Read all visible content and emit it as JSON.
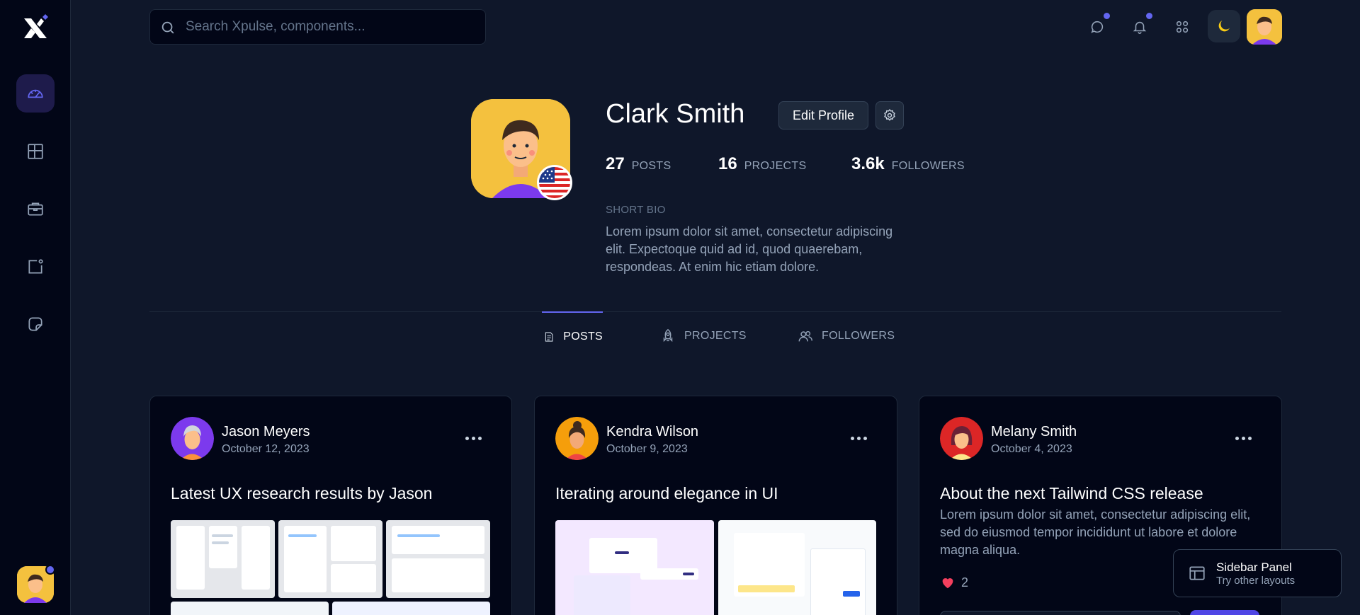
{
  "search": {
    "placeholder": "Search Xpulse, components..."
  },
  "profile": {
    "name": "Clark Smith",
    "edit_label": "Edit Profile",
    "stats": [
      {
        "value": "27",
        "label": "POSTS"
      },
      {
        "value": "16",
        "label": "PROJECTS"
      },
      {
        "value": "3.6k",
        "label": "FOLLOWERS"
      }
    ],
    "bio_label": "SHORT BIO",
    "bio": "Lorem ipsum dolor sit amet, consectetur adipiscing elit. Expectoque quid ad id, quod quaerebam, respondeas. At enim hic etiam dolore."
  },
  "tabs": [
    {
      "label": "POSTS",
      "icon": "document-icon",
      "active": true
    },
    {
      "label": "PROJECTS",
      "icon": "rocket-icon",
      "active": false
    },
    {
      "label": "FOLLOWERS",
      "icon": "users-icon",
      "active": false
    }
  ],
  "posts": [
    {
      "author": "Jason Meyers",
      "date": "October 12, 2023",
      "title": "Latest UX research results by Jason",
      "avatar_color": "#7c3aed"
    },
    {
      "author": "Kendra Wilson",
      "date": "October 9, 2023",
      "title": "Iterating around elegance in UI",
      "avatar_color": "#f59e0b"
    },
    {
      "author": "Melany Smith",
      "date": "October 4, 2023",
      "title": "About the next Tailwind CSS release",
      "text": "Lorem ipsum dolor sit amet, consectetur adipiscing elit, sed do eiusmod tempor incididunt ut labore et dolore magna aliqua.",
      "likes": "2",
      "avatar_color": "#dc2626"
    }
  ],
  "panel_toast": {
    "title": "Sidebar Panel",
    "subtitle": "Try other layouts"
  },
  "colors": {
    "accent": "#6366f1",
    "background": "#0f172a",
    "sidebar": "#020617",
    "avatar_yellow": "#f4c13e"
  }
}
